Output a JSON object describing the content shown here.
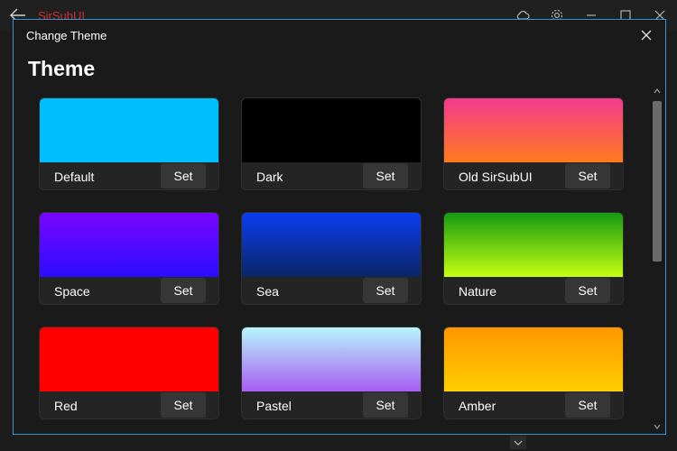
{
  "app": {
    "title": "SirSubUI"
  },
  "dialog": {
    "title": "Change Theme",
    "heading": "Theme",
    "set_label": "Set"
  },
  "themes": [
    {
      "name": "Default",
      "colors": [
        "#00bfff",
        "#00bfff"
      ]
    },
    {
      "name": "Dark",
      "colors": [
        "#000000",
        "#000000"
      ]
    },
    {
      "name": "Old SirSubUI",
      "colors": [
        "#f43a8f",
        "#ff7a1c"
      ]
    },
    {
      "name": "Space",
      "colors": [
        "#7a06ff",
        "#2b0cff"
      ]
    },
    {
      "name": "Sea",
      "colors": [
        "#0b3df2",
        "#0b2566"
      ]
    },
    {
      "name": "Nature",
      "colors": [
        "#159a13",
        "#c6ff10"
      ]
    },
    {
      "name": "Red",
      "colors": [
        "#ff0000",
        "#ff0000"
      ]
    },
    {
      "name": "Pastel",
      "colors": [
        "#b6f6fb",
        "#a85cf3"
      ]
    },
    {
      "name": "Amber",
      "colors": [
        "#ff9600",
        "#ffcf00"
      ]
    }
  ],
  "accent": "#2e93d1",
  "icons": [
    "back-arrow-icon",
    "cloud-icon",
    "gear-icon",
    "minimize-icon",
    "maximize-icon",
    "close-icon",
    "chevron-up-icon",
    "chevron-down-icon"
  ]
}
